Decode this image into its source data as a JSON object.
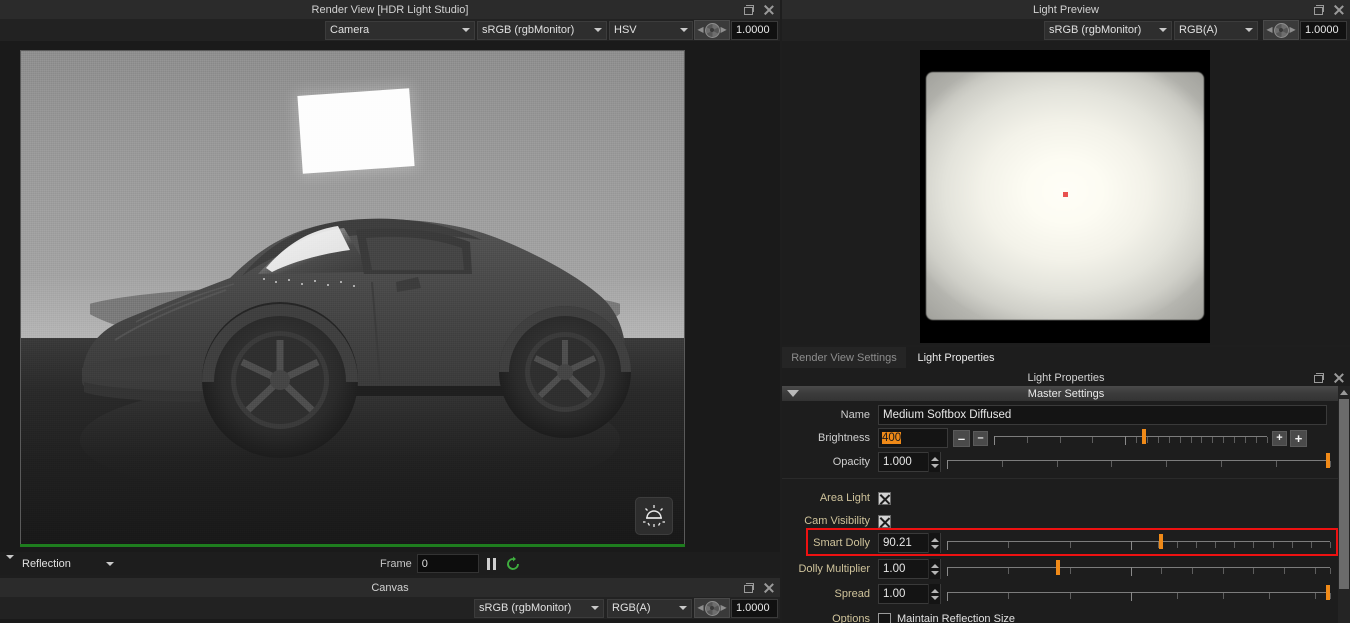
{
  "render_view": {
    "title": "Render View [HDR Light Studio]",
    "toolbar": {
      "camera_select": "Camera",
      "colorspace_select": "sRGB (rgbMonitor)",
      "channel_select": "HSV",
      "exposure_value": "1.0000",
      "aperture_icon": "aperture-icon"
    },
    "bottom": {
      "reflection_select": "Reflection",
      "frame_label": "Frame",
      "frame_value": "0",
      "pause_icon": "pause-icon",
      "loop_icon": "refresh-loop-icon",
      "sun_icon": "sun-light-icon"
    },
    "window_buttons": {
      "float": "float-icon",
      "close": "close-icon"
    }
  },
  "canvas_panel": {
    "title": "Canvas",
    "toolbar": {
      "colorspace_select": "sRGB (rgbMonitor)",
      "channel_select": "RGB(A)",
      "exposure_value": "1.0000",
      "aperture_icon": "aperture-icon"
    },
    "window_buttons": {
      "float": "float-icon",
      "close": "close-icon"
    }
  },
  "light_preview": {
    "title": "Light Preview",
    "toolbar": {
      "colorspace_select": "sRGB (rgbMonitor)",
      "channel_select": "RGB(A)",
      "exposure_value": "1.0000",
      "aperture_icon": "aperture-icon"
    },
    "window_buttons": {
      "float": "float-icon",
      "close": "close-icon"
    }
  },
  "tabs": [
    {
      "label": "Render View Settings",
      "active": false
    },
    {
      "label": "Light Properties",
      "active": true
    }
  ],
  "light_properties": {
    "title": "Light Properties",
    "section_header": "Master Settings",
    "window_buttons": {
      "float": "float-icon",
      "close": "close-icon"
    },
    "rows": {
      "name": {
        "label": "Name",
        "value": "Medium Softbox Diffused"
      },
      "brightness": {
        "label": "Brightness",
        "value": "400",
        "value_selected": true,
        "minus_big": "–",
        "minus_small": "–",
        "plus_small": "+",
        "plus_big": "+",
        "slider_percent": 55
      },
      "opacity": {
        "label": "Opacity",
        "value": "1.000",
        "slider_percent": 99.5
      },
      "area_light": {
        "label": "Area Light",
        "checked": true
      },
      "cam_visibility": {
        "label": "Cam Visibility",
        "checked": true
      },
      "smart_dolly": {
        "label": "Smart Dolly",
        "value": "90.21",
        "slider_percent": 65,
        "highlighted": true
      },
      "dolly_multiplier": {
        "label": "Dolly Multiplier",
        "value": "1.00",
        "slider_percent": 30
      },
      "spread": {
        "label": "Spread",
        "value": "1.00",
        "slider_percent": 99.5
      },
      "options": {
        "label": "Options",
        "checkbox_label": "Maintain Reflection Size",
        "checked": false
      }
    }
  },
  "colors": {
    "accent_orange": "#f08a18",
    "highlight_red": "#ee1111",
    "label_tan": "#cfc39b",
    "panel_bg": "#1d1d1d",
    "title_bg": "#2b2b2b",
    "status_green": "#1e7d1e"
  }
}
